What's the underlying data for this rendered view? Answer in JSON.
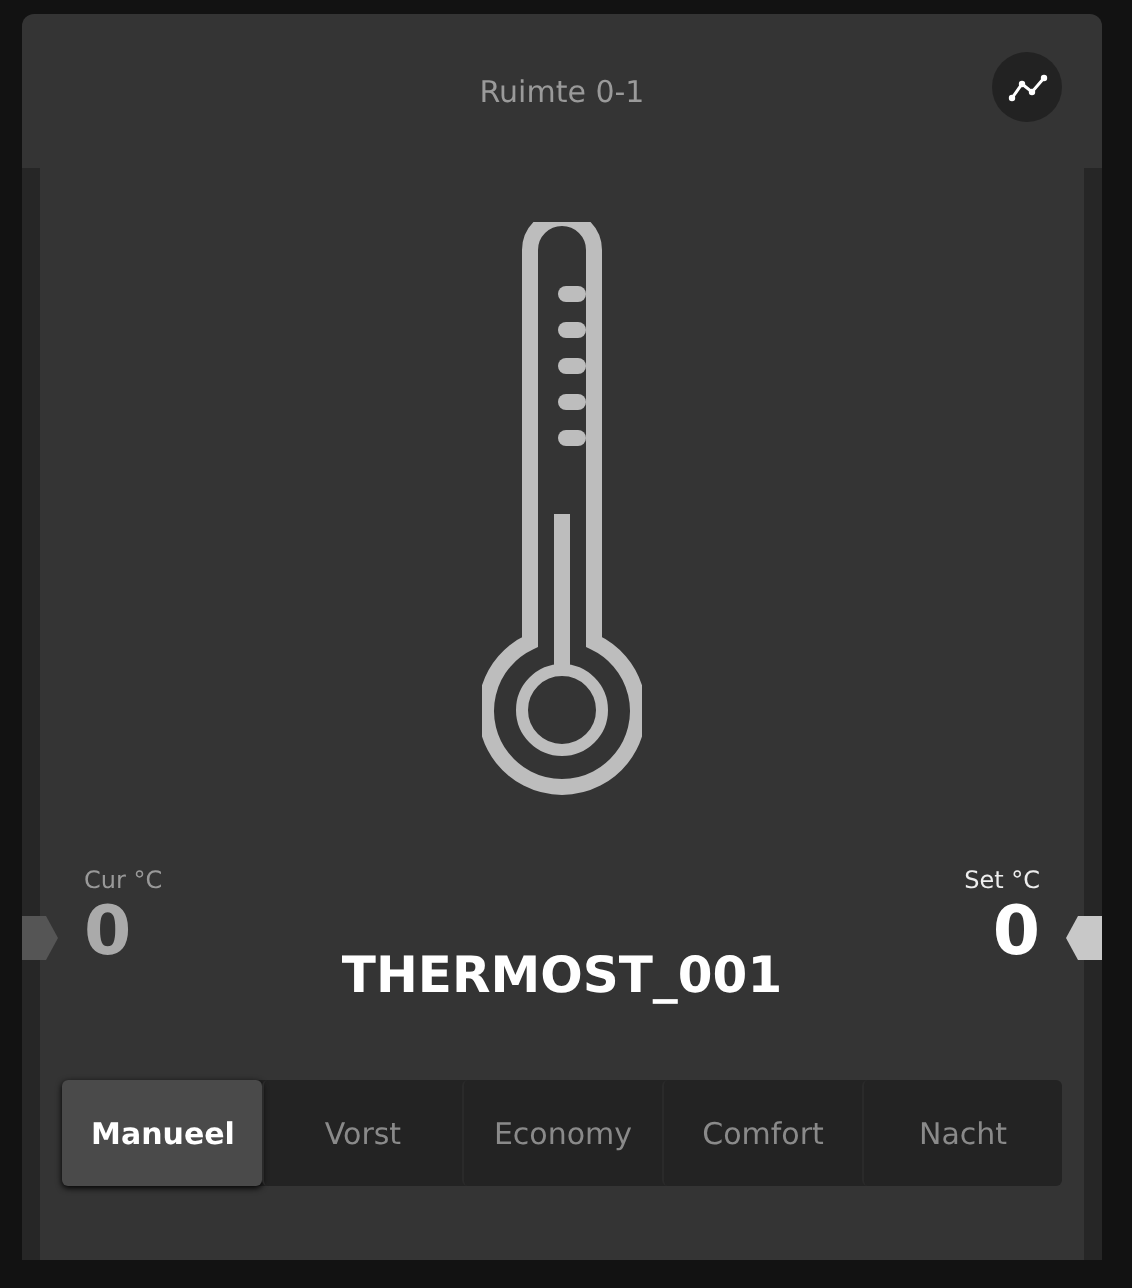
{
  "title": "Ruimte 0-1",
  "current": {
    "label": "Cur °C",
    "value": "0"
  },
  "setpoint": {
    "label": "Set °C",
    "value": "0"
  },
  "device_name": "THERMOST_001",
  "modes": [
    {
      "label": "Manueel",
      "selected": true
    },
    {
      "label": "Vorst",
      "selected": false
    },
    {
      "label": "Economy",
      "selected": false
    },
    {
      "label": "Comfort",
      "selected": false
    },
    {
      "label": "Nacht",
      "selected": false
    }
  ]
}
